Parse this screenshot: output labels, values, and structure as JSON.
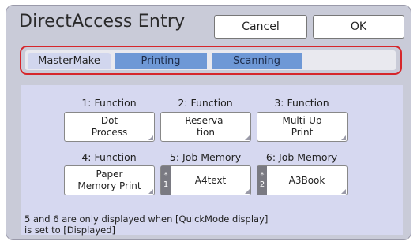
{
  "header": {
    "title": "DirectAccess Entry",
    "cancel_label": "Cancel",
    "ok_label": "OK"
  },
  "tabs": [
    {
      "label": "MasterMake",
      "selected": true
    },
    {
      "label": "Printing",
      "selected": false
    },
    {
      "label": "Scanning",
      "selected": false
    }
  ],
  "functions": [
    {
      "label": "1: Function",
      "button": "Dot\nProcess"
    },
    {
      "label": "2: Function",
      "button": "Reserva-\ntion"
    },
    {
      "label": "3: Function",
      "button": "Multi-Up\nPrint"
    },
    {
      "label": "4: Function",
      "button": "Paper\nMemory Print"
    },
    {
      "label": "5: Job Memory",
      "button": "A4text",
      "tag_symbol": "*",
      "tag_number": "1"
    },
    {
      "label": "6: Job Memory",
      "button": "A3Book",
      "tag_symbol": "*",
      "tag_number": "2"
    }
  ],
  "note": "5 and 6 are only displayed when [QuickMode display]\nis set to [Displayed]",
  "colors": {
    "highlight_border": "#d6262b",
    "tab_inactive": "#6e98d6",
    "panel": "#d6d8f0",
    "screen_bg": "#c9cbd8"
  }
}
